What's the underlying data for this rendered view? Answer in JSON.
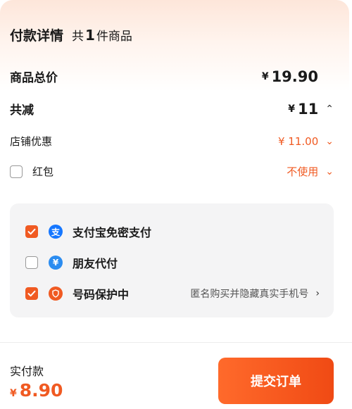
{
  "header": {
    "title": "付款详情",
    "count_prefix": "共",
    "count": "1",
    "count_suffix": "件商品"
  },
  "total_price": {
    "label": "商品总价",
    "currency": "¥",
    "value": "19.90"
  },
  "discount_total": {
    "label": "共减",
    "currency": "¥",
    "value": "11",
    "chevron": "up"
  },
  "shop_discount": {
    "label": "店铺优惠",
    "value": "¥ 11.00",
    "chevron": "down"
  },
  "red_packet": {
    "label": "红包",
    "checked": false,
    "value": "不使用",
    "chevron": "down"
  },
  "payment_options": [
    {
      "label": "支付宝免密支付",
      "checked": true,
      "icon": "alipay-icon",
      "icon_color": "#1677ff"
    },
    {
      "label": "朋友代付",
      "checked": false,
      "icon": "friend-pay-icon",
      "icon_color": "#2b8cf0"
    },
    {
      "label": "号码保护中",
      "checked": true,
      "icon": "shield-icon",
      "icon_color": "#f05a22",
      "sub": "匿名购买并隐藏真实手机号"
    }
  ],
  "footer": {
    "label": "实付款",
    "currency": "¥",
    "value": "8.90",
    "submit_label": "提交订单"
  },
  "colors": {
    "accent": "#f05a22",
    "box_bg": "#f4f4f5"
  }
}
